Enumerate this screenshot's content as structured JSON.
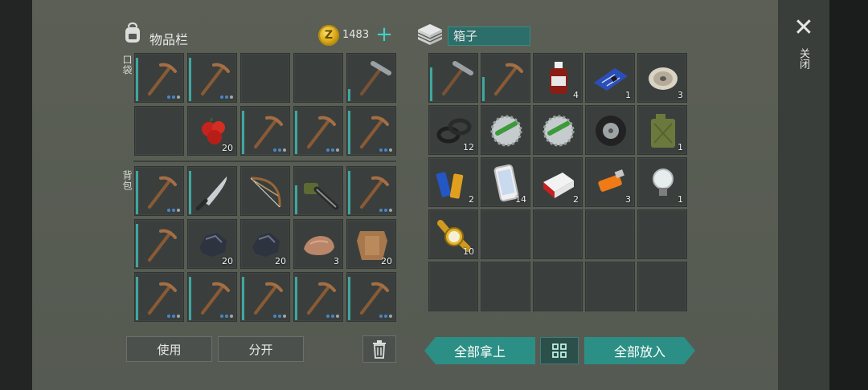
{
  "inventory": {
    "title": "物品栏",
    "currency_icon": "coin-icon",
    "currency_letter": "Z",
    "currency_amount": "1483",
    "add_currency": "+",
    "pocket_label": "口袋",
    "backpack_label": "背包"
  },
  "pocket_slots": [
    {
      "item": "pickaxe-icon",
      "durability": 0.9,
      "dots": 3
    },
    {
      "item": "pickaxe-icon",
      "durability": 0.9,
      "dots": 3
    },
    {
      "item": "",
      "durability": 0,
      "dots": 0
    },
    {
      "item": "",
      "durability": 0,
      "dots": 0
    },
    {
      "item": "hammer-pickaxe-icon",
      "durability": 0.25,
      "dots": 0
    },
    {
      "item": "",
      "durability": 0,
      "dots": 0
    },
    {
      "item": "apple-icon",
      "count": "20"
    },
    {
      "item": "pickaxe-icon",
      "durability": 0.9,
      "dots": 3
    },
    {
      "item": "pickaxe-icon",
      "durability": 0.9,
      "dots": 3
    },
    {
      "item": "pickaxe-icon",
      "durability": 0.9,
      "dots": 3
    }
  ],
  "backpack_slots": [
    {
      "item": "pickaxe-icon",
      "durability": 0.9,
      "dots": 3
    },
    {
      "item": "machete-icon",
      "durability": 0.9,
      "dots": 0
    },
    {
      "item": "bow-icon",
      "durability": 0,
      "dots": 0
    },
    {
      "item": "chainsaw-icon",
      "durability": 0.6,
      "dots": 0
    },
    {
      "item": "pickaxe-icon",
      "durability": 0.9,
      "dots": 3
    },
    {
      "item": "pickaxe-icon",
      "durability": 0.9,
      "dots": 0
    },
    {
      "item": "coal-icon",
      "count": "20"
    },
    {
      "item": "coal-icon",
      "count": "20"
    },
    {
      "item": "stone-icon",
      "count": "3"
    },
    {
      "item": "leather-icon",
      "count": "20"
    },
    {
      "item": "pickaxe-icon",
      "durability": 0.9,
      "dots": 3
    },
    {
      "item": "pickaxe-icon",
      "durability": 0.9,
      "dots": 3
    },
    {
      "item": "pickaxe-icon",
      "durability": 0.9,
      "dots": 3
    },
    {
      "item": "pickaxe-icon",
      "durability": 0.9,
      "dots": 3
    },
    {
      "item": "pickaxe-icon",
      "durability": 0.9,
      "dots": 3
    }
  ],
  "box": {
    "icon": "crate-icon",
    "name": "箱子",
    "slots": [
      {
        "item": "hammer-pickaxe-icon",
        "durability": 0.7
      },
      {
        "item": "pickaxe-icon",
        "durability": 0.5
      },
      {
        "item": "bottle-icon",
        "count": "4"
      },
      {
        "item": "circuit-board-icon",
        "count": "1"
      },
      {
        "item": "wire-spool-icon",
        "count": "3"
      },
      {
        "item": "rubber-rings-icon",
        "count": "12"
      },
      {
        "item": "saw-blade-icon"
      },
      {
        "item": "saw-blade-icon"
      },
      {
        "item": "tire-icon"
      },
      {
        "item": "jerrycan-icon",
        "count": "1"
      },
      {
        "item": "batteries-icon",
        "count": "2"
      },
      {
        "item": "phone-icon",
        "count": "14"
      },
      {
        "item": "cigarettes-icon",
        "count": "2"
      },
      {
        "item": "usb-drive-icon",
        "count": "3"
      },
      {
        "item": "light-bulb-icon",
        "count": "1"
      },
      {
        "item": "gold-watch-icon",
        "count": "10"
      }
    ]
  },
  "buttons": {
    "use": "使用",
    "split": "分开",
    "trash_icon": "trash-icon",
    "take_all": "全部拿上",
    "sort_icon": "grid-icon",
    "put_all": "全部放入",
    "close": "关闭",
    "close_icon": "close-icon"
  },
  "colors": {
    "accent": "#2c8f86",
    "durability": "#3fa7a0",
    "slot": "#3a3f3d"
  }
}
